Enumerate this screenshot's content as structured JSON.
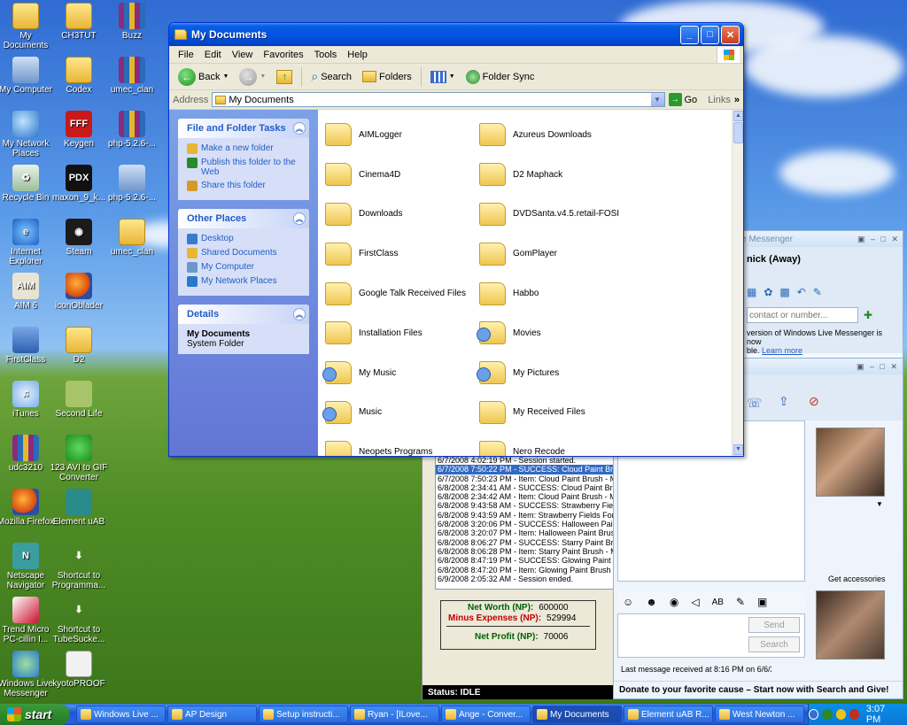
{
  "desktop": {
    "icons": [
      {
        "label": "My Documents",
        "icon": "folder-icon"
      },
      {
        "label": "CH3TUT",
        "icon": "folder-icon"
      },
      {
        "label": "Buzz",
        "icon": "rar-icon"
      },
      {
        "label": "My Computer",
        "icon": "computer-icon"
      },
      {
        "label": "Codex",
        "icon": "folder-icon"
      },
      {
        "label": "umec_clan",
        "icon": "rar-icon"
      },
      {
        "label": "My Network Places",
        "icon": "network-icon"
      },
      {
        "label": "Keygen",
        "icon": "fff-icon"
      },
      {
        "label": "php-5.2.6-...",
        "icon": "rar-icon"
      },
      {
        "label": "Recycle Bin",
        "icon": "recycle-bin-icon"
      },
      {
        "label": "maxon_9_k...",
        "icon": "pdx-icon"
      },
      {
        "label": "php-5.2.6-...",
        "icon": "installer-icon"
      },
      {
        "label": "Internet Explorer",
        "icon": "ie-icon"
      },
      {
        "label": "Steam",
        "icon": "steam-icon"
      },
      {
        "label": "umec_clan",
        "icon": "folder-icon"
      },
      {
        "label": "AIM 6",
        "icon": "aim-icon"
      },
      {
        "label": "iconOblader",
        "icon": "firefox-icon"
      },
      {
        "label": "FirstClass",
        "icon": "firstclass-icon"
      },
      {
        "label": "D2",
        "icon": "folder-icon"
      },
      {
        "label": "iTunes",
        "icon": "itunes-icon"
      },
      {
        "label": "Second Life",
        "icon": "second-life-icon"
      },
      {
        "label": "udc3210",
        "icon": "rar-icon"
      },
      {
        "label": "123 AVI to GIF Converter",
        "icon": "avi-gif-icon"
      },
      {
        "label": "Mozilla Firefox",
        "icon": "firefox-icon"
      },
      {
        "label": "Element uAB",
        "icon": "element-icon"
      },
      {
        "label": "Netscape Navigator",
        "icon": "netscape-icon"
      },
      {
        "label": "Shortcut to Programma...",
        "icon": "shortcut-icon"
      },
      {
        "label": "Trend Micro PC-cillin I...",
        "icon": "trend-micro-icon"
      },
      {
        "label": "Shortcut to TubeSucke...",
        "icon": "shortcut-icon"
      },
      {
        "label": "Windows Live Messenger",
        "icon": "messenger-icon"
      },
      {
        "label": "kyotoPROOF",
        "icon": "document-icon"
      }
    ]
  },
  "explorer": {
    "title": "My Documents",
    "menu": [
      "File",
      "Edit",
      "View",
      "Favorites",
      "Tools",
      "Help"
    ],
    "toolbar": {
      "back": "Back",
      "search": "Search",
      "folders": "Folders",
      "folder_sync": "Folder Sync"
    },
    "address": {
      "label": "Address",
      "value": "My Documents",
      "go": "Go",
      "links": "Links"
    },
    "tasks": {
      "file_folder": {
        "title": "File and Folder Tasks",
        "items": [
          "Make a new folder",
          "Publish this folder to the Web",
          "Share this folder"
        ]
      },
      "other_places": {
        "title": "Other Places",
        "items": [
          "Desktop",
          "Shared Documents",
          "My Computer",
          "My Network Places"
        ]
      },
      "details": {
        "title": "Details",
        "name": "My Documents",
        "type": "System Folder"
      }
    },
    "files": [
      "AIMLogger",
      "Azureus Downloads",
      "Cinema4D",
      "D2 Maphack",
      "Downloads",
      "DVDSanta.v4.5.retail-FOSI",
      "FirstClass",
      "GomPlayer",
      "Google Talk Received Files",
      "Habbo",
      "Installation Files",
      "Movies",
      "My Music",
      "My Pictures",
      "Music",
      "My Received Files",
      "Neopets Programs",
      "Nero Recode"
    ]
  },
  "messenger": {
    "title": "Windows Live Messenger",
    "status": "nick (Away)",
    "search_placeholder": "contact or number...",
    "notice": "version of Windows Live Messenger is now",
    "notice2": "ble.",
    "learn_more": "Learn more"
  },
  "convo": {
    "partial_text": "ay.",
    "get_accessories": "Get accessories",
    "send": "Send",
    "search": "Search",
    "last_message": "Last message received at 8:16 PM on 6/6/2",
    "donate": "Donate to your favorite cause – Start now with Search and Give!"
  },
  "element": {
    "log": [
      "6/7/2008 4:02:19 PM - Session started.",
      "6/7/2008 7:50:22 PM - SUCCESS: Cloud Paint Brus",
      "6/7/2008 7:50:23 PM - Item: Cloud Paint Brush - Mo",
      "6/8/2008 2:34:41 AM - SUCCESS: Cloud Paint Brus",
      "6/8/2008 2:34:42 AM - Item: Cloud Paint Brush - Mo",
      "6/8/2008 9:43:58 AM - SUCCESS: Strawberry Fields",
      "6/8/2008 9:43:59 AM - Item: Strawberry Fields Forev",
      "6/8/2008 3:20:06 PM - SUCCESS: Halloween Paint",
      "6/8/2008 3:20:07 PM - Item: Halloween Paint Brush",
      "6/8/2008 8:06:27 PM - SUCCESS: Starry Paint Brush",
      "6/8/2008 8:06:28 PM - Item: Starry Paint Brush - Mo",
      "6/8/2008 8:47:19 PM - SUCCESS: Glowing Paint Br",
      "6/8/2008 8:47:20 PM - Item: Glowing Paint Brush - Mo",
      "6/9/2008 2:05:32 AM - Session ended."
    ],
    "net_worth_label": "Net Worth (NP):",
    "net_worth": "600000",
    "minus_label": "Minus Expenses (NP):",
    "minus": "529994",
    "profit_label": "Net Profit (NP):",
    "profit": "70006",
    "status": "Status: IDLE"
  },
  "taskbar": {
    "start": "start",
    "tasks": [
      "Windows Live ...",
      "AP Design",
      "Setup instructi...",
      "Ryan - [ILove...",
      "Ange - Conver...",
      "My Documents",
      "Element uAB R...",
      "West Newton ..."
    ],
    "clock": "3:07 PM"
  },
  "colors": {
    "xp_blue": "#0054e3",
    "task_pane": "#6f86da",
    "link_blue": "#215dc6",
    "start_green": "#2e8a2e",
    "expense_red": "#c00000",
    "log_selected": "#316ac5"
  }
}
